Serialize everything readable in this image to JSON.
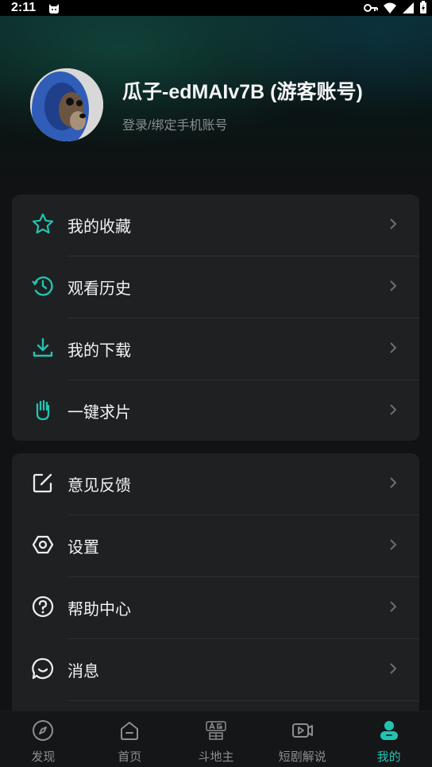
{
  "status_bar": {
    "time": "2:11"
  },
  "profile": {
    "name": "瓜子-edMAIv7B (游客账号)",
    "login_text": "登录/绑定手机账号"
  },
  "menu_group_1": [
    {
      "label": "我的收藏",
      "icon": "star-icon"
    },
    {
      "label": "观看历史",
      "icon": "history-icon"
    },
    {
      "label": "我的下载",
      "icon": "download-icon"
    },
    {
      "label": "一键求片",
      "icon": "hand-icon"
    }
  ],
  "menu_group_2": [
    {
      "label": "意见反馈",
      "icon": "feedback-icon"
    },
    {
      "label": "设置",
      "icon": "settings-icon"
    },
    {
      "label": "帮助中心",
      "icon": "help-icon"
    },
    {
      "label": "消息",
      "icon": "message-icon"
    }
  ],
  "bottom_nav": [
    {
      "label": "发现",
      "icon": "compass-icon",
      "active": false
    },
    {
      "label": "首页",
      "icon": "home-icon",
      "active": false
    },
    {
      "label": "斗地主",
      "icon": "ag-game-icon",
      "active": false
    },
    {
      "label": "短剧解说",
      "icon": "video-icon",
      "active": false
    },
    {
      "label": "我的",
      "icon": "profile-icon",
      "active": true
    }
  ],
  "colors": {
    "accent": "#22c3b2",
    "card": "#1f2021",
    "background": "#111213"
  }
}
